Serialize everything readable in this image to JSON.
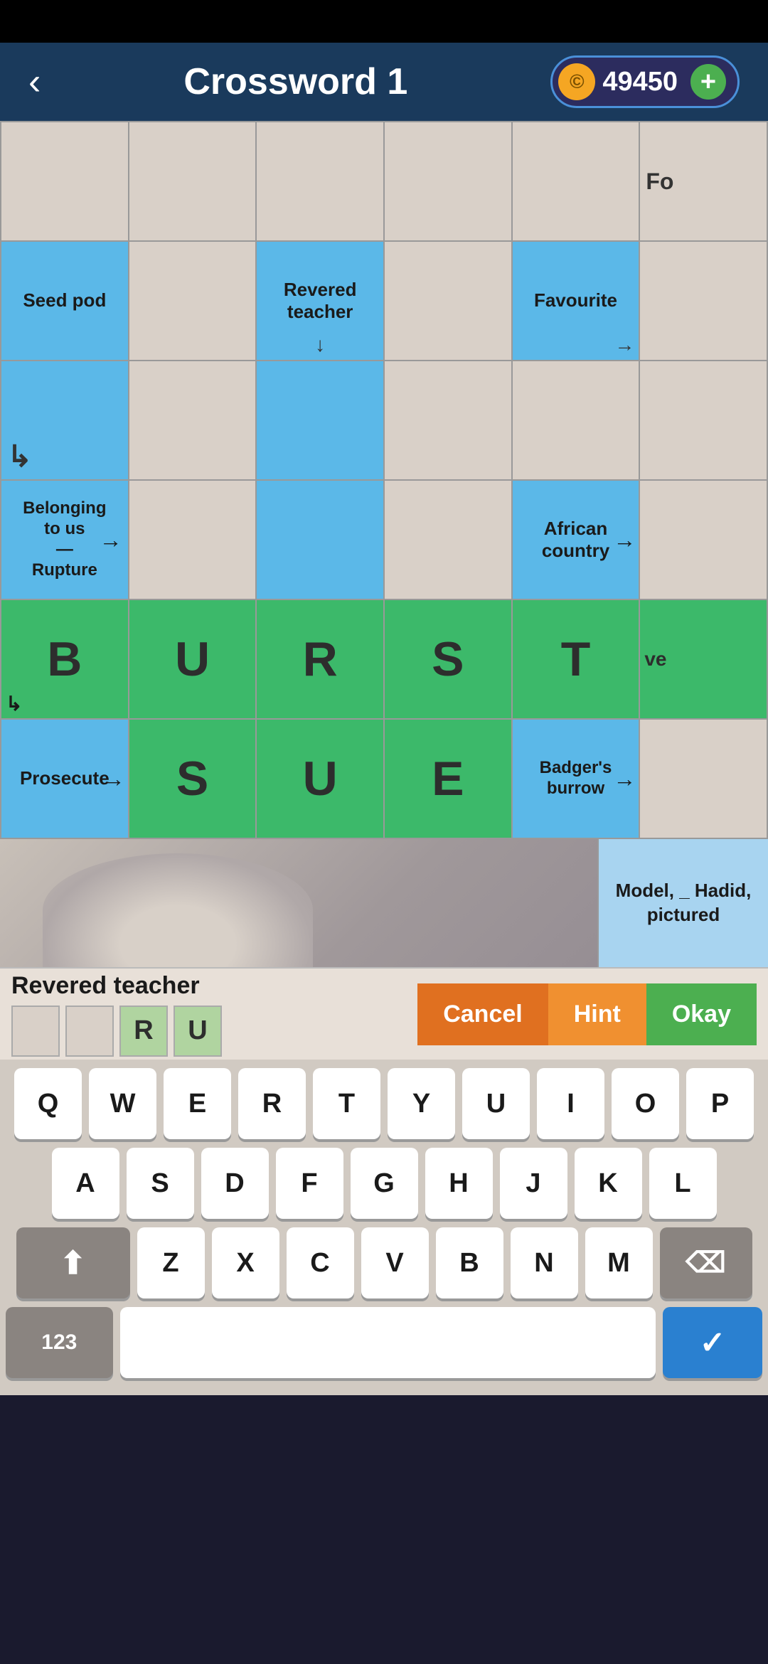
{
  "header": {
    "back_label": "‹",
    "title": "Crossword 1",
    "coins": "49450",
    "coin_symbol": "©",
    "add_symbol": "+"
  },
  "grid": {
    "rows": [
      [
        {
          "type": "light",
          "text": "",
          "clue": "",
          "arrow": ""
        },
        {
          "type": "light",
          "text": "",
          "clue": "",
          "arrow": ""
        },
        {
          "type": "light",
          "text": "",
          "clue": "",
          "arrow": ""
        },
        {
          "type": "light",
          "text": "",
          "clue": "",
          "arrow": ""
        },
        {
          "type": "light",
          "text": "",
          "clue": "",
          "arrow": ""
        },
        {
          "type": "light",
          "text": "Fo",
          "clue": "",
          "arrow": ""
        }
      ],
      [
        {
          "type": "clue-blue",
          "text": "Seed pod",
          "clue": "",
          "arrow": ""
        },
        {
          "type": "light",
          "text": "",
          "clue": "",
          "arrow": ""
        },
        {
          "type": "clue-blue",
          "text": "Revered teacher",
          "clue": "",
          "arrow": "arrow-down"
        },
        {
          "type": "light",
          "text": "",
          "clue": "",
          "arrow": ""
        },
        {
          "type": "clue-blue",
          "text": "Favourite",
          "clue": "",
          "arrow": "arrow-right"
        },
        {
          "type": "light",
          "text": "",
          "clue": "",
          "arrow": ""
        }
      ],
      [
        {
          "type": "clue-blue",
          "text": "↳",
          "clue": "",
          "arrow": "arrow-down-left"
        },
        {
          "type": "light",
          "text": "",
          "clue": "",
          "arrow": ""
        },
        {
          "type": "clue-blue",
          "text": "",
          "clue": "",
          "arrow": ""
        },
        {
          "type": "light",
          "text": "",
          "clue": "",
          "arrow": ""
        },
        {
          "type": "light",
          "text": "",
          "clue": "",
          "arrow": ""
        },
        {
          "type": "light",
          "text": "",
          "clue": "",
          "arrow": ""
        }
      ],
      [
        {
          "type": "clue-blue",
          "text": "Belonging to us\n—\nRupture",
          "clue": "",
          "arrow": "arrow-right"
        },
        {
          "type": "light",
          "text": "",
          "clue": "",
          "arrow": ""
        },
        {
          "type": "clue-blue",
          "text": "",
          "clue": "",
          "arrow": ""
        },
        {
          "type": "light",
          "text": "",
          "clue": "",
          "arrow": ""
        },
        {
          "type": "clue-blue",
          "text": "African country",
          "clue": "",
          "arrow": "arrow-right"
        },
        {
          "type": "light",
          "text": "",
          "clue": "",
          "arrow": ""
        }
      ],
      [
        {
          "type": "green",
          "text": "B",
          "clue": "",
          "arrow": "arrow-down-left"
        },
        {
          "type": "green",
          "text": "U",
          "clue": "",
          "arrow": ""
        },
        {
          "type": "green",
          "text": "R",
          "clue": "",
          "arrow": ""
        },
        {
          "type": "green",
          "text": "S",
          "clue": "",
          "arrow": ""
        },
        {
          "type": "green",
          "text": "T",
          "clue": "",
          "arrow": ""
        },
        {
          "type": "green-partial",
          "text": "ve",
          "clue": "",
          "arrow": ""
        }
      ],
      [
        {
          "type": "clue-blue",
          "text": "Prosecute",
          "clue": "",
          "arrow": "arrow-right"
        },
        {
          "type": "green",
          "text": "S",
          "clue": "",
          "arrow": ""
        },
        {
          "type": "green",
          "text": "U",
          "clue": "",
          "arrow": ""
        },
        {
          "type": "green",
          "text": "E",
          "clue": "",
          "arrow": ""
        },
        {
          "type": "clue-blue",
          "text": "Badger's burrow",
          "clue": "",
          "arrow": "arrow-right"
        },
        {
          "type": "light",
          "text": "",
          "clue": "",
          "arrow": ""
        }
      ]
    ]
  },
  "image_area": {
    "clue_right": "Model, _\nHadid,\npictured"
  },
  "clue_bar": {
    "clue_text": "Revered teacher",
    "answer_boxes": [
      "",
      "",
      "R",
      "U"
    ],
    "cancel_label": "Cancel",
    "hint_label": "Hint",
    "okay_label": "Okay"
  },
  "keyboard": {
    "row1": [
      "Q",
      "W",
      "E",
      "R",
      "T",
      "Y",
      "U",
      "I",
      "O",
      "P"
    ],
    "row2": [
      "A",
      "S",
      "D",
      "F",
      "G",
      "H",
      "J",
      "K",
      "L"
    ],
    "row3_shift": "⬆",
    "row3": [
      "Z",
      "X",
      "C",
      "V",
      "B",
      "N",
      "M"
    ],
    "row3_back": "⌫",
    "row4_123": "123",
    "row4_space": "",
    "row4_enter": "✓"
  }
}
